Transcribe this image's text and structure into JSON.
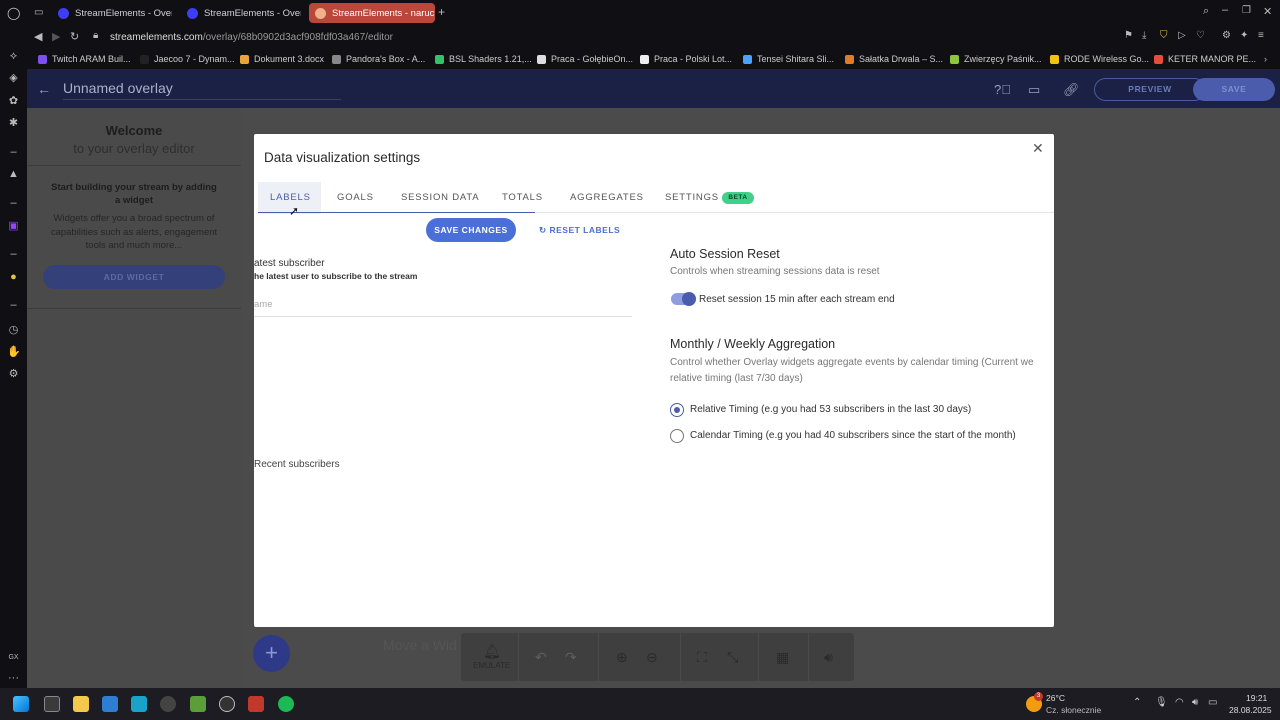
{
  "browser": {
    "tabs": [
      {
        "title": "StreamElements - Overlay"
      },
      {
        "title": "StreamElements - Overlay"
      },
      {
        "title": "StreamElements - naruci"
      }
    ],
    "url_host": "streamelements.com",
    "url_path": "/overlay/68b0902d3acf908fdf03a467/editor",
    "bookmarks": [
      {
        "label": "Twitch ARAM Buil...",
        "color": "#7b4ff0"
      },
      {
        "label": "Jaecoo 7 - Dynam...",
        "color": "#222222"
      },
      {
        "label": "Dokument 3.docx",
        "color": "#e8a33a"
      },
      {
        "label": "Pandora's Box - A...",
        "color": "#888888"
      },
      {
        "label": "BSL Shaders 1.21,...",
        "color": "#32c36a"
      },
      {
        "label": "Praca - GołębieOn...",
        "color": "#dddddd"
      },
      {
        "label": "Praca - Polski Lot...",
        "color": "#eeeeee"
      },
      {
        "label": "Tensei Shitara Sli...",
        "color": "#4aa3ff"
      },
      {
        "label": "Sałatka Drwala – S...",
        "color": "#e07b2a"
      },
      {
        "label": "Zwierzęcy Paśnik...",
        "color": "#8cc63f"
      },
      {
        "label": "RODE Wireless Go...",
        "color": "#f1c40f"
      },
      {
        "label": "KETER MANOR PE...",
        "color": "#e74c3c"
      }
    ]
  },
  "app": {
    "title": "Unnamed overlay",
    "preview_label": "PREVIEW",
    "save_label": "SAVE"
  },
  "left_panel": {
    "welcome_line1": "Welcome",
    "welcome_line2": "to your overlay editor",
    "start_title": "Start building your stream by adding a widget",
    "start_desc": "Widgets offer you a broad spectrum of capabilities such as alerts, engagement tools and much more...",
    "add_widget_label": "ADD WIDGET"
  },
  "canvas": {
    "move_hint": "Move a Wid",
    "fab_label": "+",
    "emulate_label": "EMULATE"
  },
  "modal": {
    "title": "Data visualization settings",
    "close_glyph": "✕",
    "tabs": [
      {
        "label": "LABELS"
      },
      {
        "label": "GOALS"
      },
      {
        "label": "SESSION DATA"
      },
      {
        "label": "TOTALS"
      },
      {
        "label": "AGGREGATES"
      },
      {
        "label": "SETTINGS"
      }
    ],
    "beta_badge": "BETA",
    "save_changes_label": "SAVE CHANGES",
    "reset_labels_label": "RESET LABELS",
    "latest_subscriber": {
      "title": "atest subscriber",
      "desc": "he latest user to subscribe to the stream",
      "placeholder": "ame"
    },
    "recent_subscribers_title": "Recent subscribers",
    "auto_session_reset": {
      "title": "Auto Session Reset",
      "desc": "Controls when streaming sessions data is reset",
      "toggle_label": "Reset session 15 min after each stream end",
      "toggle_on": true
    },
    "aggregation": {
      "title": "Monthly / Weekly Aggregation",
      "desc_line1": "Control whether Overlay widgets aggregate events by calendar timing (Current we",
      "desc_line2": "relative timing (last 7/30 days)",
      "options": [
        {
          "label": "Relative Timing (e.g you had 53 subscribers in the last 30 days)",
          "selected": true
        },
        {
          "label": "Calendar Timing (e.g you had 40 subscribers since the start of the month)",
          "selected": false
        }
      ]
    }
  },
  "taskbar": {
    "weather_temp": "26°C",
    "weather_desc": "Cz. słonecznie",
    "weather_badge": "3",
    "time": "19:21",
    "date": "28.08.2025"
  },
  "sidebar_labels": {
    "gx": "GX",
    "more": "···"
  }
}
